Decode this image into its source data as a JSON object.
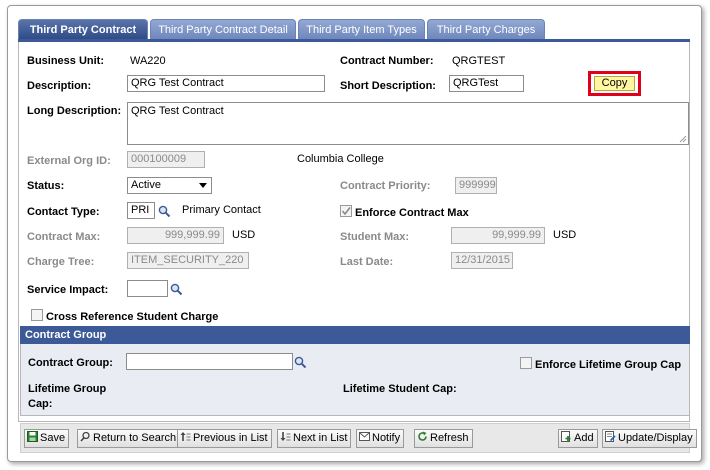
{
  "tabs": [
    {
      "label": "Third Party Contract"
    },
    {
      "label": "Third Party Contract Detail"
    },
    {
      "label": "Third Party Item Types"
    },
    {
      "label": "Third Party Charges"
    }
  ],
  "form": {
    "business_unit_label": "Business Unit:",
    "business_unit_value": "WA220",
    "contract_number_label": "Contract Number:",
    "contract_number_value": "QRGTEST",
    "description_label": "Description:",
    "description_value": "QRG Test Contract",
    "short_description_label": "Short Description:",
    "short_description_value": "QRGTest",
    "copy_label": "Copy",
    "long_description_label": "Long Description:",
    "long_description_value": "QRG Test Contract",
    "external_org_label": "External Org ID:",
    "external_org_value": "000100009",
    "external_org_name": "Columbia College",
    "status_label": "Status:",
    "status_value": "Active",
    "contract_priority_label": "Contract Priority:",
    "contract_priority_value": "999999",
    "contact_type_label": "Contact Type:",
    "contact_type_value": "PRI",
    "contact_type_desc": "Primary Contact",
    "enforce_contract_max_label": "Enforce Contract Max",
    "enforce_contract_max_checked": true,
    "contract_max_label": "Contract Max:",
    "contract_max_value": "999,999.99",
    "contract_max_currency": "USD",
    "student_max_label": "Student Max:",
    "student_max_value": "99,999.99",
    "student_max_currency": "USD",
    "charge_tree_label": "Charge Tree:",
    "charge_tree_value": "ITEM_SECURITY_220",
    "last_date_label": "Last Date:",
    "last_date_value": "12/31/2015",
    "service_impact_label": "Service Impact:",
    "service_impact_value": "",
    "cross_reference_label": "Cross Reference Student Charge",
    "cross_reference_checked": false
  },
  "contract_group": {
    "header": "Contract Group",
    "group_label": "Contract Group:",
    "group_value": "",
    "enforce_lifetime_label": "Enforce Lifetime Group Cap",
    "enforce_lifetime_checked": false,
    "lifetime_group_cap_line1": "Lifetime Group",
    "lifetime_group_cap_line2": "Cap:",
    "lifetime_student_cap_label": "Lifetime Student Cap:"
  },
  "toolbar": {
    "save": "Save",
    "return_to_search": "Return to Search",
    "previous_in_list": "Previous in List",
    "next_in_list": "Next in List",
    "notify": "Notify",
    "refresh": "Refresh",
    "add": "Add",
    "update_display": "Update/Display"
  },
  "colors": {
    "tab_active": "#2c4a86",
    "tab_inactive": "#7f95c6",
    "group_header": "#3b5a97",
    "highlight": "#e0001a",
    "copy_button": "#fff7a1"
  }
}
